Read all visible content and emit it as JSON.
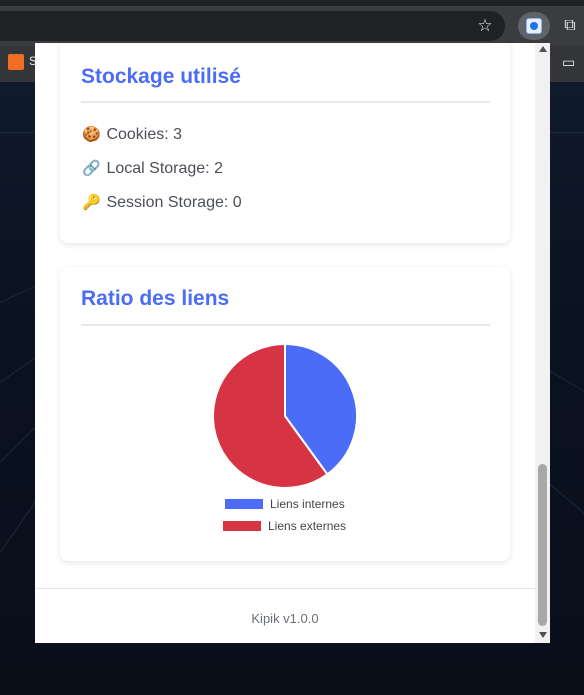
{
  "browser": {
    "star_icon": "star-icon",
    "extension_icon": "kipik-extension-icon",
    "puzzle_icon": "puzzle-icon",
    "bookmark_label": "S",
    "bookmark_icon": "soundcloud-icon",
    "folder_icon": "folder-icon"
  },
  "storage": {
    "title": "Stockage utilisé",
    "items": [
      {
        "icon": "cookie-icon",
        "emoji": "🍪",
        "label": "Cookies:",
        "value": "3"
      },
      {
        "icon": "link-icon",
        "emoji": "🔗",
        "label": "Local Storage:",
        "value": "2"
      },
      {
        "icon": "key-icon",
        "emoji": "🔑",
        "label": "Session Storage:",
        "value": "0"
      }
    ]
  },
  "links": {
    "title": "Ratio des liens",
    "chart_data": {
      "type": "pie",
      "categories": [
        "Liens internes",
        "Liens externes"
      ],
      "values": [
        40,
        60
      ],
      "colors": [
        "#4a6cf7",
        "#d63443"
      ],
      "legend_position": "bottom"
    }
  },
  "footer": {
    "text": "Kipik v1.0.0"
  }
}
